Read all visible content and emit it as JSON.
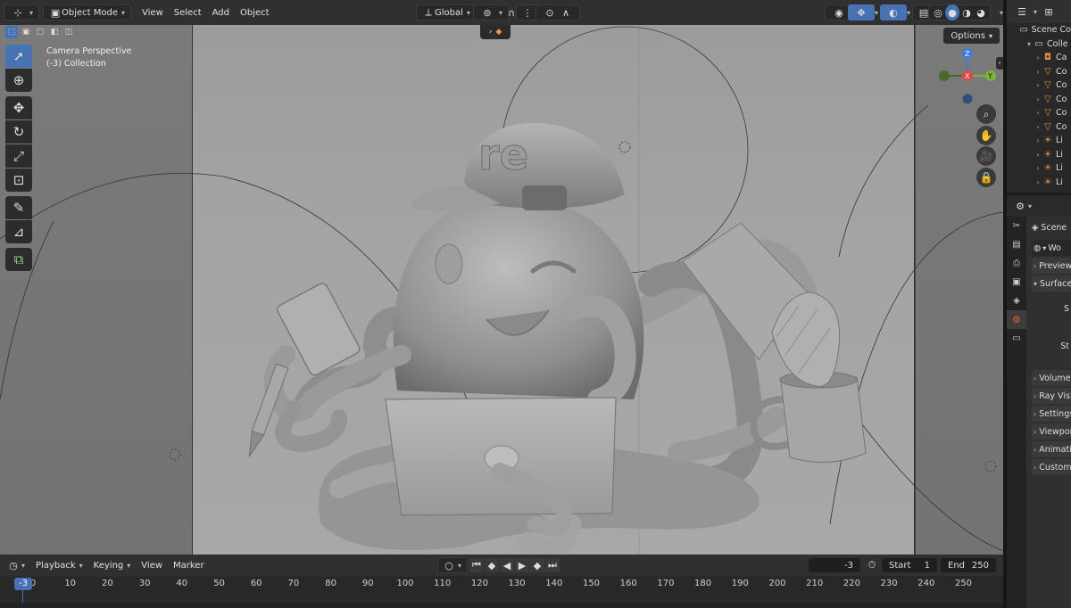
{
  "header": {
    "mode": "Object Mode",
    "menus": [
      "View",
      "Select",
      "Add",
      "Object"
    ],
    "transform_orientation": "Global"
  },
  "viewport": {
    "overlay_line1": "Camera Perspective",
    "overlay_line2": "(-3) Collection",
    "options_label": "Options",
    "cap_text": "re",
    "gizmo_axes": {
      "z": "Z",
      "y": "Y",
      "x": "X"
    },
    "colors": {
      "x_axis": "#e04848",
      "y_axis": "#7ab534",
      "z_axis": "#3d7be0",
      "active_tool": "#4772b3"
    }
  },
  "timeline": {
    "menus": [
      "Playback",
      "Keying",
      "View",
      "Marker"
    ],
    "current_frame": "-3",
    "start_label": "Start",
    "start_value": "1",
    "end_label": "End",
    "end_value": "250",
    "ruler_current": "-3",
    "ticks": [
      "0",
      "10",
      "20",
      "30",
      "40",
      "50",
      "60",
      "70",
      "80",
      "90",
      "100",
      "110",
      "120",
      "130",
      "140",
      "150",
      "160",
      "170",
      "180",
      "190",
      "200",
      "210",
      "220",
      "230",
      "240",
      "250"
    ]
  },
  "outliner": {
    "scene_label": "Scene Co",
    "collection_label": "Colle",
    "rows": [
      {
        "icon": "camera-icon",
        "label": "Ca"
      },
      {
        "icon": "mesh-icon",
        "label": "Co"
      },
      {
        "icon": "mesh-icon",
        "label": "Co"
      },
      {
        "icon": "mesh-icon",
        "label": "Co"
      },
      {
        "icon": "mesh-icon",
        "label": "Co"
      },
      {
        "icon": "mesh-icon",
        "label": "Co"
      },
      {
        "icon": "light-icon",
        "label": "Li"
      },
      {
        "icon": "light-icon",
        "label": "Li"
      },
      {
        "icon": "light-icon",
        "label": "Li"
      },
      {
        "icon": "light-icon",
        "label": "Li"
      }
    ]
  },
  "properties": {
    "scene_label": "Scene",
    "world_label": "Wo",
    "panels": [
      "Preview",
      "Surface",
      "Volume",
      "Ray Visi",
      "Settings",
      "Viewport",
      "Animati",
      "Custom"
    ],
    "surface_fields": [
      "S",
      "St"
    ]
  }
}
